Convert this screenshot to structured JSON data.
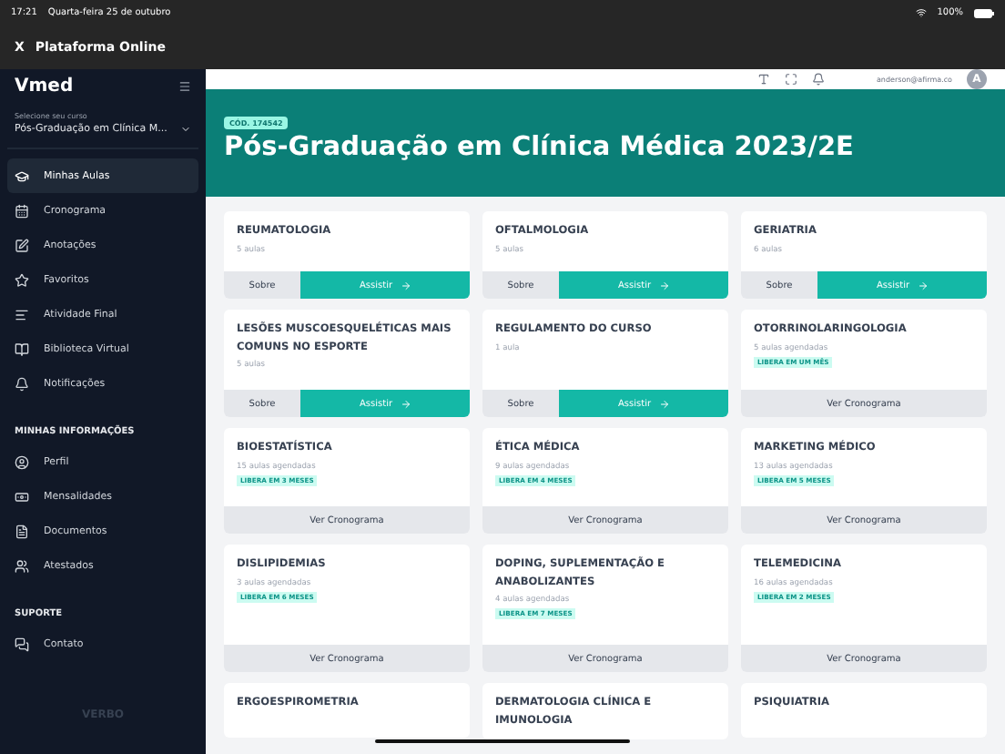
{
  "status_bar": {
    "time": "17:21",
    "date": "Quarta-feira 25 de outubro",
    "battery": "100%"
  },
  "window": {
    "close": "X",
    "title": "Plataforma Online"
  },
  "sidebar": {
    "logo": "Vmed",
    "course_label": "Selecione seu curso",
    "course": "Pós-Graduação em Clínica M...",
    "sections": [
      {
        "items": [
          {
            "label": "Minhas Aulas",
            "selected": true
          },
          {
            "label": "Cronograma",
            "selected": false
          },
          {
            "label": "Anotações",
            "selected": false
          },
          {
            "label": "Favoritos",
            "selected": false
          },
          {
            "label": "Atividade Final",
            "selected": false
          },
          {
            "label": "Biblioteca Virtual",
            "selected": false
          },
          {
            "label": "Notificações",
            "selected": false
          }
        ]
      },
      {
        "heading": "MINHAS INFORMAÇÕES",
        "items": [
          {
            "label": "Perfil",
            "selected": false
          },
          {
            "label": "Mensalidades",
            "selected": false
          },
          {
            "label": "Documentos",
            "selected": false
          },
          {
            "label": "Atestados",
            "selected": false
          }
        ]
      },
      {
        "heading": "SUPORTE",
        "items": [
          {
            "label": "Contato",
            "selected": false
          }
        ]
      }
    ],
    "footer": "VERBO"
  },
  "header": {
    "email": "anderson@afirma.co",
    "avatar": "A"
  },
  "banner": {
    "code": "CÓD. 174542",
    "title": "Pós-Graduação em Clínica Médica 2023/2E"
  },
  "cards": [
    {
      "kind": "watch",
      "title": "REUMATOLOGIA",
      "subtitle": "5 aulas",
      "about": "Sobre",
      "action": "Assistir"
    },
    {
      "kind": "watch",
      "title": "OFTALMOLOGIA",
      "subtitle": "5 aulas",
      "about": "Sobre",
      "action": "Assistir"
    },
    {
      "kind": "watch",
      "title": "GERIATRIA",
      "subtitle": "6 aulas",
      "about": "Sobre",
      "action": "Assistir"
    },
    {
      "kind": "watch",
      "title": "LESÕES MUSCOESQUELÉTICAS MAIS COMUNS NO ESPORTE",
      "subtitle": "5 aulas",
      "about": "Sobre",
      "action": "Assistir"
    },
    {
      "kind": "watch",
      "title": "REGULAMENTO DO CURSO",
      "subtitle": "1 aula",
      "about": "Sobre",
      "action": "Assistir"
    },
    {
      "kind": "schedule",
      "title": "OTORRINOLARINGOLOGIA",
      "subtitle": "5 aulas agendadas",
      "badge": "LIBERA EM UM MÊS",
      "action": "Ver Cronograma"
    },
    {
      "kind": "schedule",
      "title": "BIOESTATÍSTICA",
      "subtitle": "15 aulas agendadas",
      "badge": "LIBERA EM 3 MESES",
      "action": "Ver Cronograma"
    },
    {
      "kind": "schedule",
      "title": "ÉTICA MÉDICA",
      "subtitle": "9 aulas agendadas",
      "badge": "LIBERA EM 4 MESES",
      "action": "Ver Cronograma"
    },
    {
      "kind": "schedule",
      "title": "MARKETING MÉDICO",
      "subtitle": "13 aulas agendadas",
      "badge": "LIBERA EM 5 MESES",
      "action": "Ver Cronograma"
    },
    {
      "kind": "schedule",
      "title": "DISLIPIDEMIAS",
      "subtitle": "3 aulas agendadas",
      "badge": "LIBERA EM 6 MESES",
      "action": "Ver Cronograma"
    },
    {
      "kind": "schedule",
      "title": "DOPING, SUPLEMENTAÇÃO E ANABOLIZANTES",
      "subtitle": "4 aulas agendadas",
      "badge": "LIBERA EM 7 MESES",
      "action": "Ver Cronograma"
    },
    {
      "kind": "schedule",
      "title": "TELEMEDICINA",
      "subtitle": "16 aulas agendadas",
      "badge": "LIBERA EM 2 MESES",
      "action": "Ver Cronograma"
    },
    {
      "kind": "partial",
      "title": "ERGOESPIROMETRIA"
    },
    {
      "kind": "partial",
      "title": "DERMATOLOGIA CLÍNICA E IMUNOLOGIA"
    },
    {
      "kind": "partial",
      "title": "PSIQUIATRIA"
    }
  ]
}
